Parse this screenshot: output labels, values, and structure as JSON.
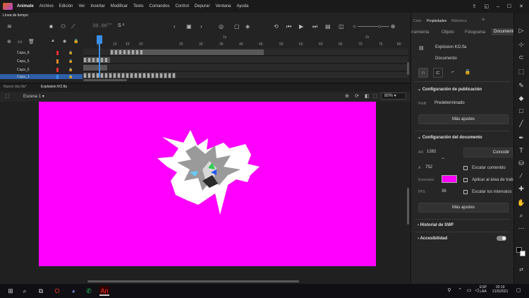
{
  "menubar": {
    "app": "Animate",
    "items": [
      "Archivo",
      "Edición",
      "Ver",
      "Insertar",
      "Modificar",
      "Texto",
      "Comandos",
      "Control",
      "Depurar",
      "Ventana",
      "Ayuda"
    ]
  },
  "timeline": {
    "tab": "Línea de tiempo",
    "frame_display": "30.00",
    "fps_suffix": "fps",
    "fps_value": "S ²",
    "seconds_marks": [
      "1s",
      "2s"
    ],
    "ruler": [
      "5",
      "10",
      "15",
      "20",
      "25",
      "30",
      "35",
      "40",
      "45",
      "50",
      "55",
      "60",
      "65",
      "70",
      "75",
      "80"
    ],
    "layers": [
      {
        "name": "Capa_8",
        "color": "#e03030"
      },
      {
        "name": "Capa_5",
        "color": "#e08a2a"
      },
      {
        "name": "Capa_6",
        "color": "#e03030"
      },
      {
        "name": "Capa_1",
        "color": "#3a8ee6"
      }
    ]
  },
  "docbar": {
    "tabs": [
      "Nuevo doc.fla*",
      "Explosion KO.fla"
    ],
    "scene": "Escena 1",
    "zoom": "80%"
  },
  "props": {
    "tabs": [
      "Color",
      "Propiedades",
      "Biblioteca"
    ],
    "subtabs": [
      "rramienta",
      "Objeto",
      "Fotograma",
      "Documento"
    ],
    "doc_name": "Explosion KO.fla",
    "doc_type": "Documento",
    "pub_title": "Configuración de publicación",
    "profile_label": "Perfil",
    "profile_value": "Predeterminado",
    "more1": "Más ajustes",
    "doc_title": "Configuración del documento",
    "w_label": "AN",
    "w_value": "1282",
    "h_label": "A",
    "h_value": "752",
    "match": "Coincidir",
    "stage_label": "Escenario",
    "stage_color": "#ff00ff",
    "fps_label": "FPS",
    "fps_value": "36",
    "chk1": "Escalar contenido",
    "chk2": "Aplicar al área de trab",
    "chk3": "Escalar los intervalos",
    "more2": "Más ajustes",
    "swf_title": "Historial de SWF",
    "access_title": "Accesibilidad"
  },
  "taskbar": {
    "lang1": "ESP",
    "lang2": "LAA",
    "time": "20:19",
    "date": "21/5/2021"
  }
}
